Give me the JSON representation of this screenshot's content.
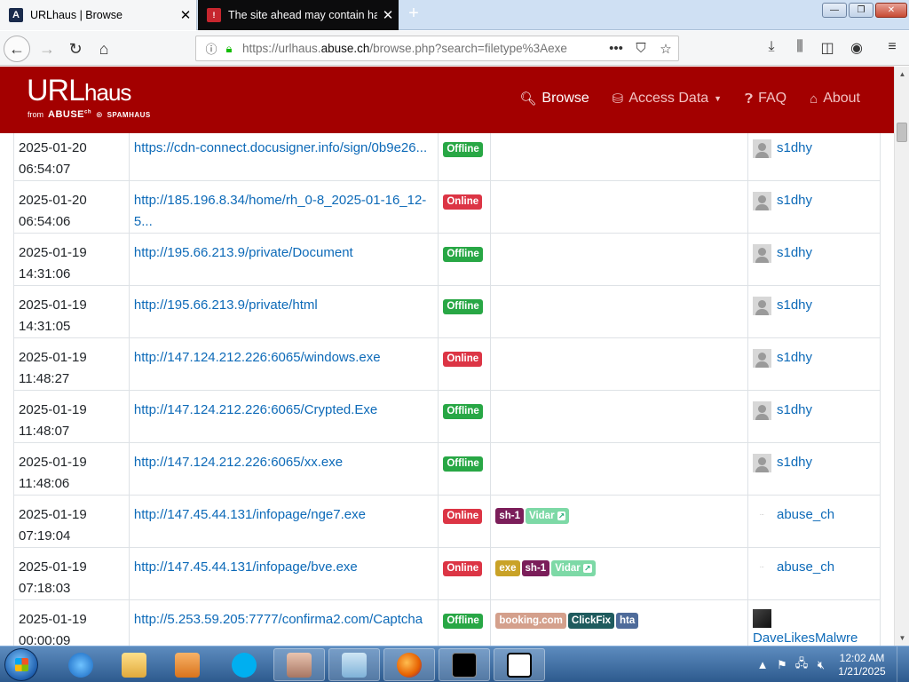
{
  "browser": {
    "tabs": [
      {
        "title": "URLhaus | Browse",
        "favicon": "A",
        "active": true
      },
      {
        "title": "The site ahead may contain ha",
        "favicon": "!",
        "active": false
      }
    ],
    "new_tab": "+",
    "url_prefix": "https://urlhaus.",
    "url_domain": "abuse.ch",
    "url_suffix": "/browse.php?search=filetype%3Aexe",
    "win_buttons": {
      "minimize": "—",
      "maximize": "❐",
      "close": "✕"
    }
  },
  "site": {
    "logo_main": "URL",
    "logo_sub": "haus",
    "from_text": "from",
    "abuse_text": "ABUSE",
    "abuse_sup": "ch",
    "spamhaus_text": "SPAMHAUS",
    "nav": [
      {
        "label": "Browse",
        "icon": "search-icon",
        "active": true
      },
      {
        "label": "Access Data",
        "icon": "database-icon",
        "active": false,
        "dropdown": true
      },
      {
        "label": "FAQ",
        "icon": "question-icon",
        "active": false
      },
      {
        "label": "About",
        "icon": "building-icon",
        "active": false
      }
    ]
  },
  "table": {
    "rows": [
      {
        "date": "2025-01-20",
        "time": "06:54:07",
        "url": "https://cdn-connect.docusigner.info/sign/0b9e26...",
        "status": "Offline",
        "tags": [],
        "reporter": "s1dhy",
        "avatar": "default"
      },
      {
        "date": "2025-01-20",
        "time": "06:54:06",
        "url": "http://185.196.8.34/home/rh_0-8_2025-01-16_12-5...",
        "status": "Online",
        "tags": [],
        "reporter": "s1dhy",
        "avatar": "default"
      },
      {
        "date": "2025-01-19",
        "time": "14:31:06",
        "url": "http://195.66.213.9/private/Document",
        "status": "Offline",
        "tags": [],
        "reporter": "s1dhy",
        "avatar": "default"
      },
      {
        "date": "2025-01-19",
        "time": "14:31:05",
        "url": "http://195.66.213.9/private/html",
        "status": "Offline",
        "tags": [],
        "reporter": "s1dhy",
        "avatar": "default"
      },
      {
        "date": "2025-01-19",
        "time": "11:48:27",
        "url": "http://147.124.212.226:6065/windows.exe",
        "status": "Online",
        "tags": [],
        "reporter": "s1dhy",
        "avatar": "default"
      },
      {
        "date": "2025-01-19",
        "time": "11:48:07",
        "url": "http://147.124.212.226:6065/Crypted.Exe",
        "status": "Offline",
        "tags": [],
        "reporter": "s1dhy",
        "avatar": "default"
      },
      {
        "date": "2025-01-19",
        "time": "11:48:06",
        "url": "http://147.124.212.226:6065/xx.exe",
        "status": "Offline",
        "tags": [],
        "reporter": "s1dhy",
        "avatar": "default"
      },
      {
        "date": "2025-01-19",
        "time": "07:19:04",
        "url": "http://147.45.44.131/infopage/nge7.exe",
        "status": "Online",
        "tags": [
          {
            "label": "sh-1",
            "color": "#7b1e5a"
          },
          {
            "label": "Vidar",
            "color": "#7dd9a6",
            "external": true
          }
        ],
        "reporter": "abuse_ch",
        "avatar": "abuse"
      },
      {
        "date": "2025-01-19",
        "time": "07:18:03",
        "url": "http://147.45.44.131/infopage/bve.exe",
        "status": "Online",
        "tags": [
          {
            "label": "exe",
            "color": "#c9a227"
          },
          {
            "label": "sh-1",
            "color": "#7b1e5a"
          },
          {
            "label": "Vidar",
            "color": "#7dd9a6",
            "external": true
          }
        ],
        "reporter": "abuse_ch",
        "avatar": "abuse"
      },
      {
        "date": "2025-01-19",
        "time": "00:00:09",
        "url": "http://5.253.59.205:7777/confirma2.com/Captcha",
        "status": "Offline",
        "tags": [
          {
            "label": "booking.com",
            "color": "#d4a08c"
          },
          {
            "label": "ClickFix",
            "color": "#1f5b5e"
          },
          {
            "label": "hta",
            "color": "#4e6b9a"
          }
        ],
        "reporter": "DaveLikesMalwre",
        "avatar": "photo"
      }
    ]
  },
  "taskbar": {
    "time": "12:02 AM",
    "date": "1/21/2025"
  },
  "colors": {
    "brand_red": "#a30000",
    "link": "#0d6ab8",
    "online": "#dc3545",
    "offline": "#28a745"
  }
}
